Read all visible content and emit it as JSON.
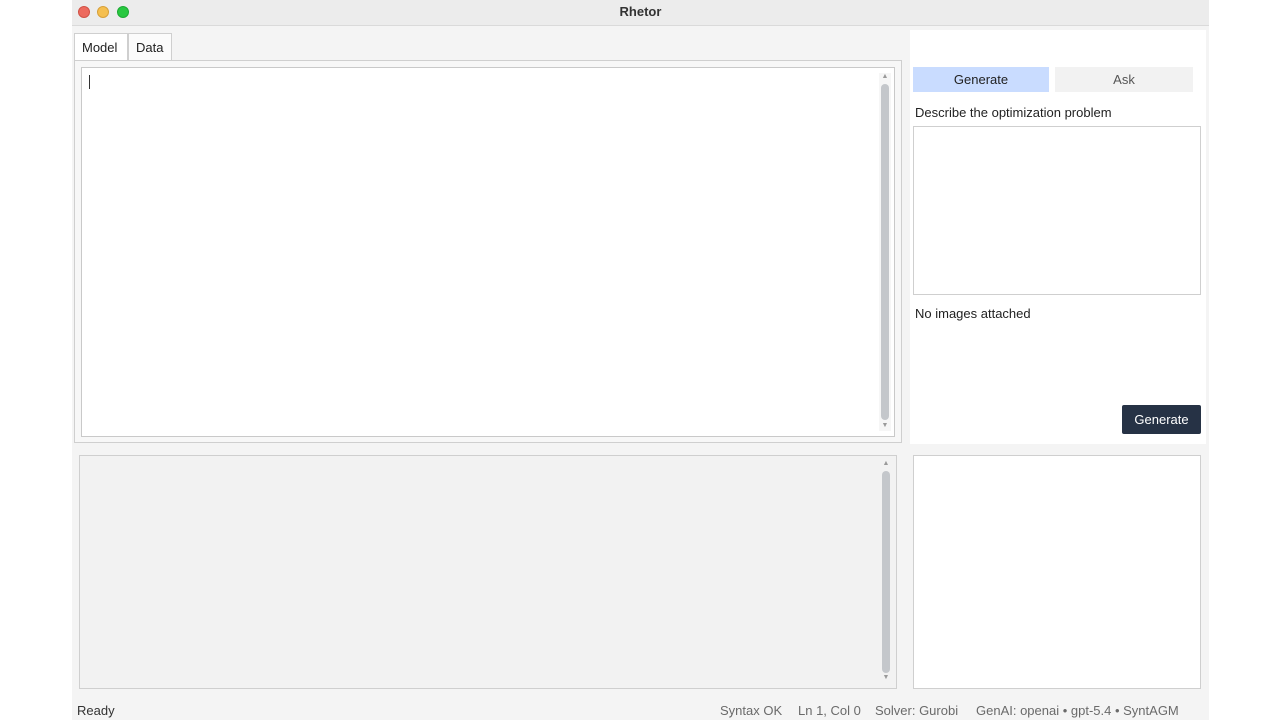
{
  "window": {
    "title": "Rhetor"
  },
  "tabs": [
    {
      "label": "Model",
      "active": true
    },
    {
      "label": "Data",
      "active": false
    }
  ],
  "editor": {
    "content": ""
  },
  "right_panel": {
    "modes": [
      {
        "label": "Generate",
        "selected": true
      },
      {
        "label": "Ask",
        "selected": false
      }
    ],
    "prompt_label": "Describe the optimization problem",
    "prompt_value": "",
    "images_status": "No images attached",
    "generate_button": "Generate"
  },
  "status_bar": {
    "state": "Ready",
    "syntax": "Syntax OK",
    "cursor": "Ln 1, Col 0",
    "solver": "Solver: Gurobi",
    "genai": "GenAI: openai • gpt-5.4 • SyntAGM"
  },
  "colors": {
    "accent_selected": "#c9dcff",
    "primary_button": "#263245"
  }
}
